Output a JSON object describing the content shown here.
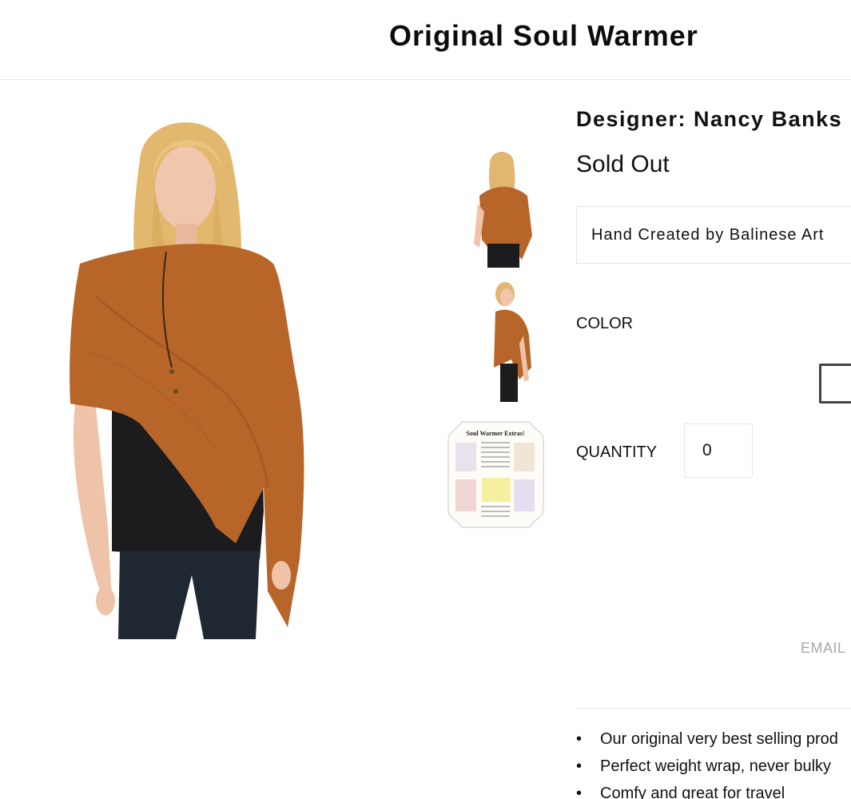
{
  "product": {
    "title": "Original Soul Warmer",
    "designer": "Designer: Nancy Banks",
    "availability": "Sold Out",
    "origin": "Hand Created by Balinese Art"
  },
  "options": {
    "color_label": "COLOR",
    "quantity_label": "QUANTITY",
    "quantity_value": "0"
  },
  "links": {
    "email": "EMAIL"
  },
  "features": [
    "Our original very best selling prod",
    "Perfect weight wrap, never bulky",
    "Comfy and great for travel"
  ],
  "colors": {
    "wrap": "#b8652a",
    "shirt": "#1c1c1e",
    "hair": "#e6c07a",
    "skin": "#eec2a9",
    "jeans": "#1f2733"
  },
  "icons": {
    "main_image": "model-wearing-rust-wrap-image",
    "thumb_1": "back-view-thumbnail",
    "thumb_2": "side-view-thumbnail",
    "thumb_3": "soul-warmer-extras-card-thumbnail"
  },
  "extras_card": {
    "heading": "Soul Warmer Extras!"
  }
}
